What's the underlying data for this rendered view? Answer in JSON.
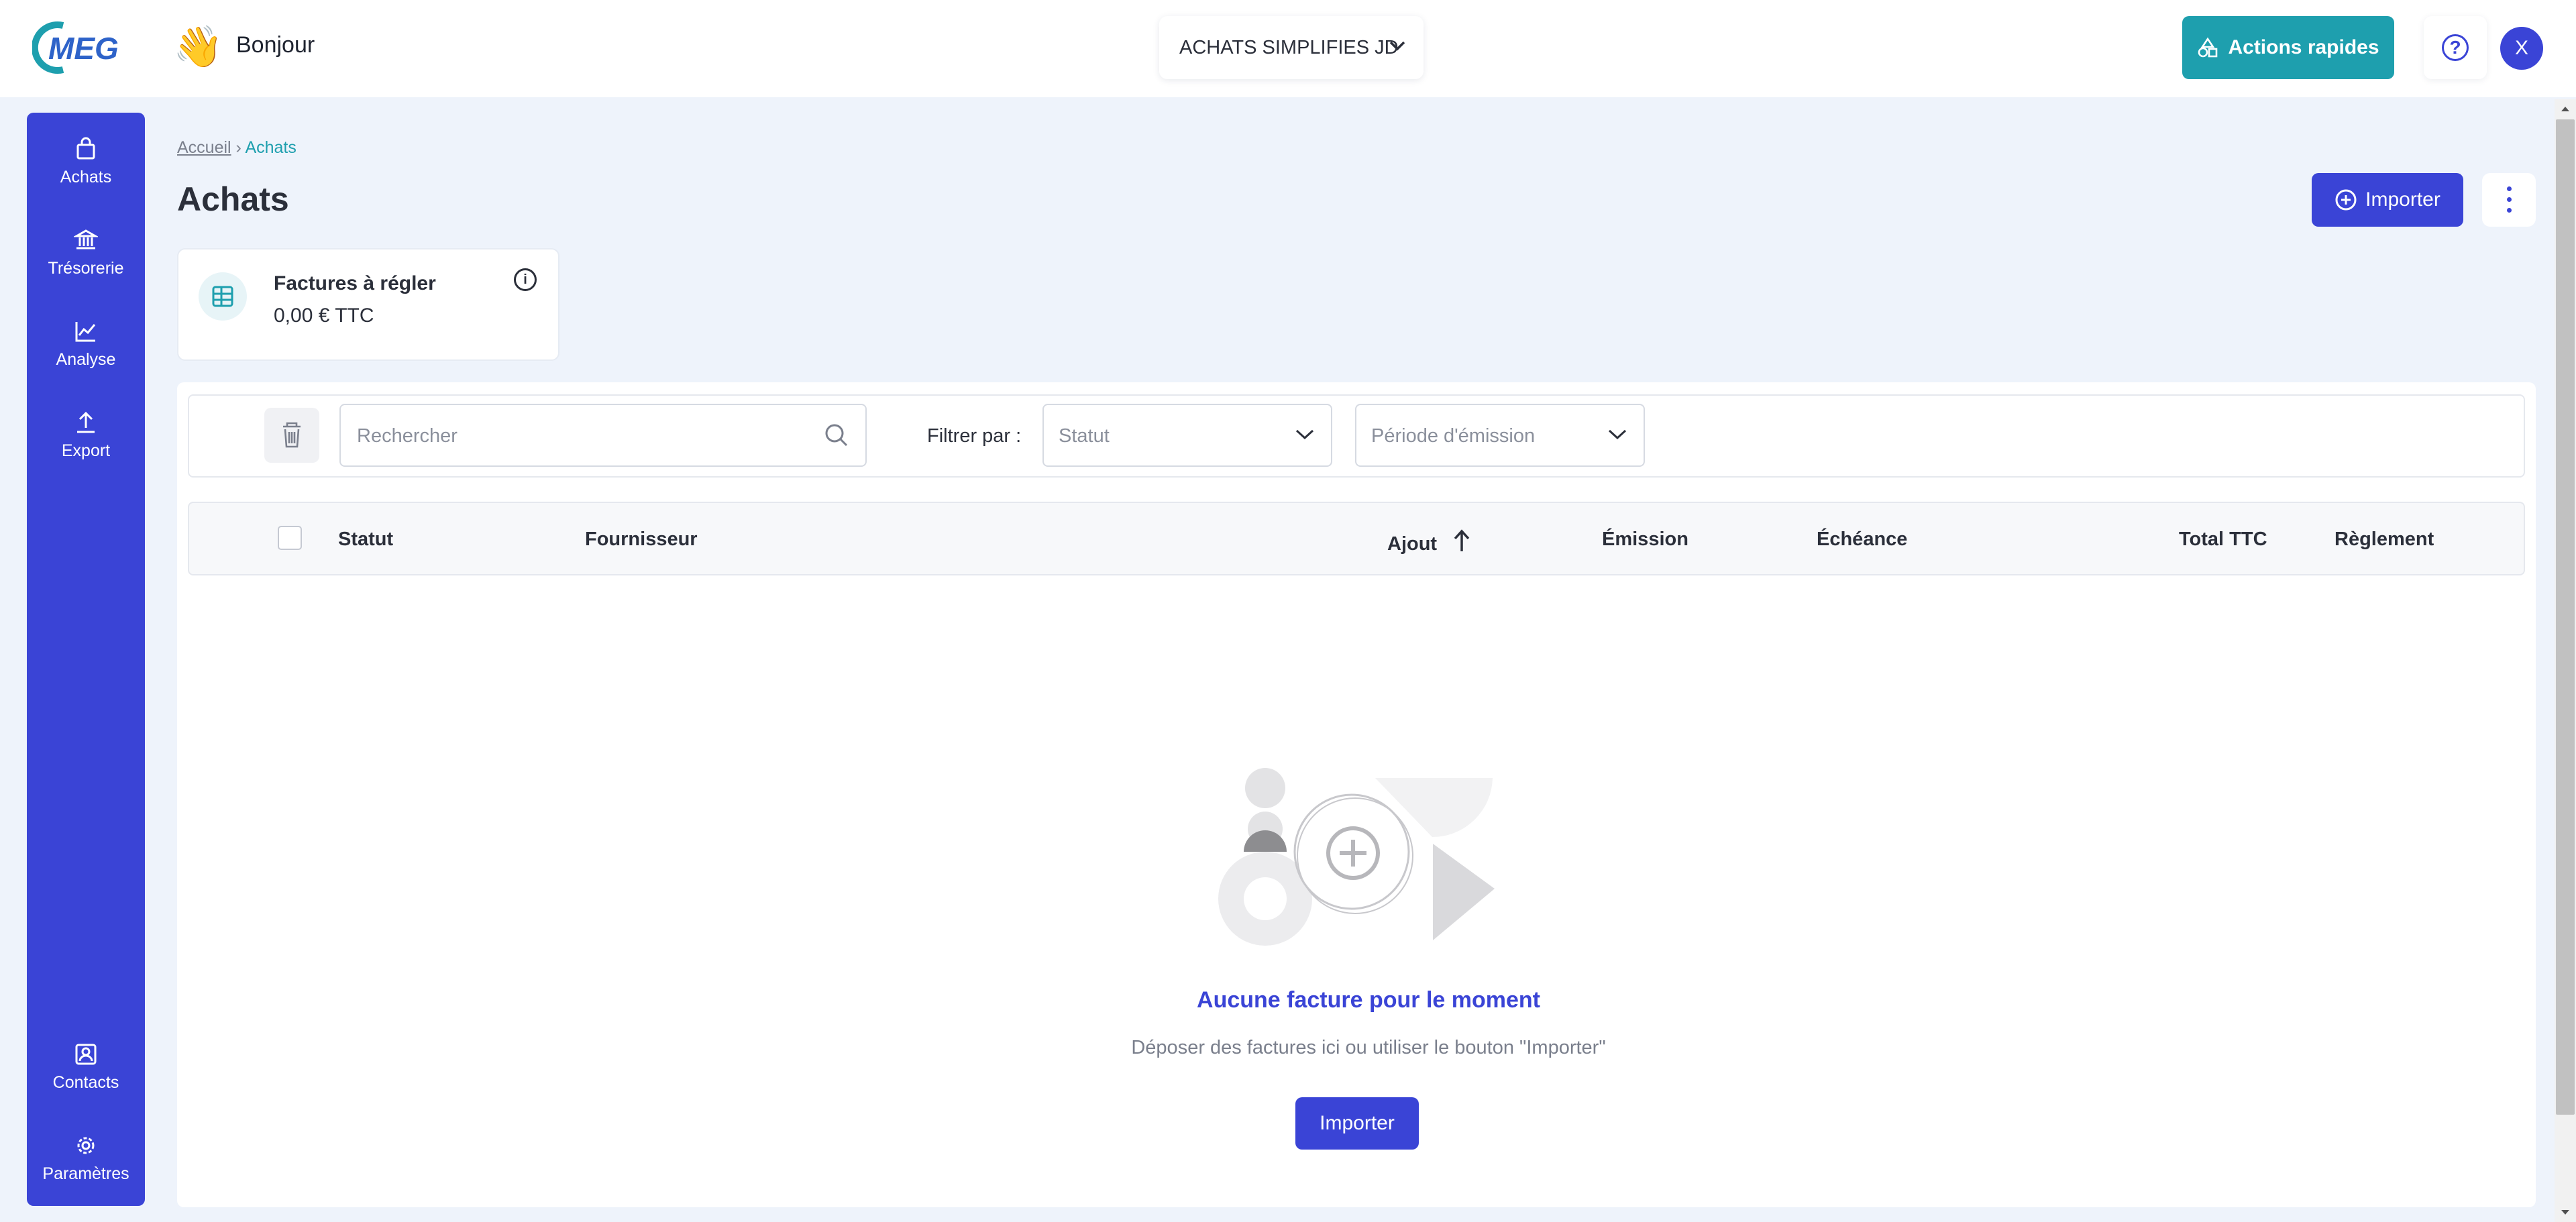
{
  "header": {
    "logo_text": "MEG",
    "greeting": "Bonjour",
    "company": "ACHATS SIMPLIFIES JD",
    "quick_actions": "Actions rapides",
    "help": "?",
    "avatar_initial": "X"
  },
  "sidebar": {
    "top_items": [
      {
        "label": "Achats",
        "icon": "shopping-bag-icon"
      },
      {
        "label": "Trésorerie",
        "icon": "bank-icon"
      },
      {
        "label": "Analyse",
        "icon": "chart-line-icon"
      },
      {
        "label": "Export",
        "icon": "upload-icon"
      }
    ],
    "bottom_items": [
      {
        "label": "Contacts",
        "icon": "contact-card-icon"
      },
      {
        "label": "Paramètres",
        "icon": "gear-icon"
      }
    ]
  },
  "breadcrumb": {
    "home": "Accueil",
    "separator": "›",
    "current": "Achats"
  },
  "page_title": "Achats",
  "import_top_label": "Importer",
  "kpi": {
    "title": "Factures à régler",
    "value": "0,00 € TTC"
  },
  "filters": {
    "search_placeholder": "Rechercher",
    "label": "Filtrer par :",
    "status_placeholder": "Statut",
    "period_placeholder": "Période d'émission"
  },
  "table": {
    "columns": [
      "Statut",
      "Fournisseur",
      "Ajout",
      "Émission",
      "Échéance",
      "Total TTC",
      "Règlement"
    ],
    "sorted_column": "Ajout",
    "sort_direction": "ascending"
  },
  "empty_state": {
    "title": "Aucune facture pour le moment",
    "subtitle": "Déposer des factures ici ou utiliser le bouton \"Importer\"",
    "button": "Importer"
  },
  "colors": {
    "primary": "#3a44d6",
    "teal": "#1e9fae",
    "background": "#eef3fb"
  }
}
